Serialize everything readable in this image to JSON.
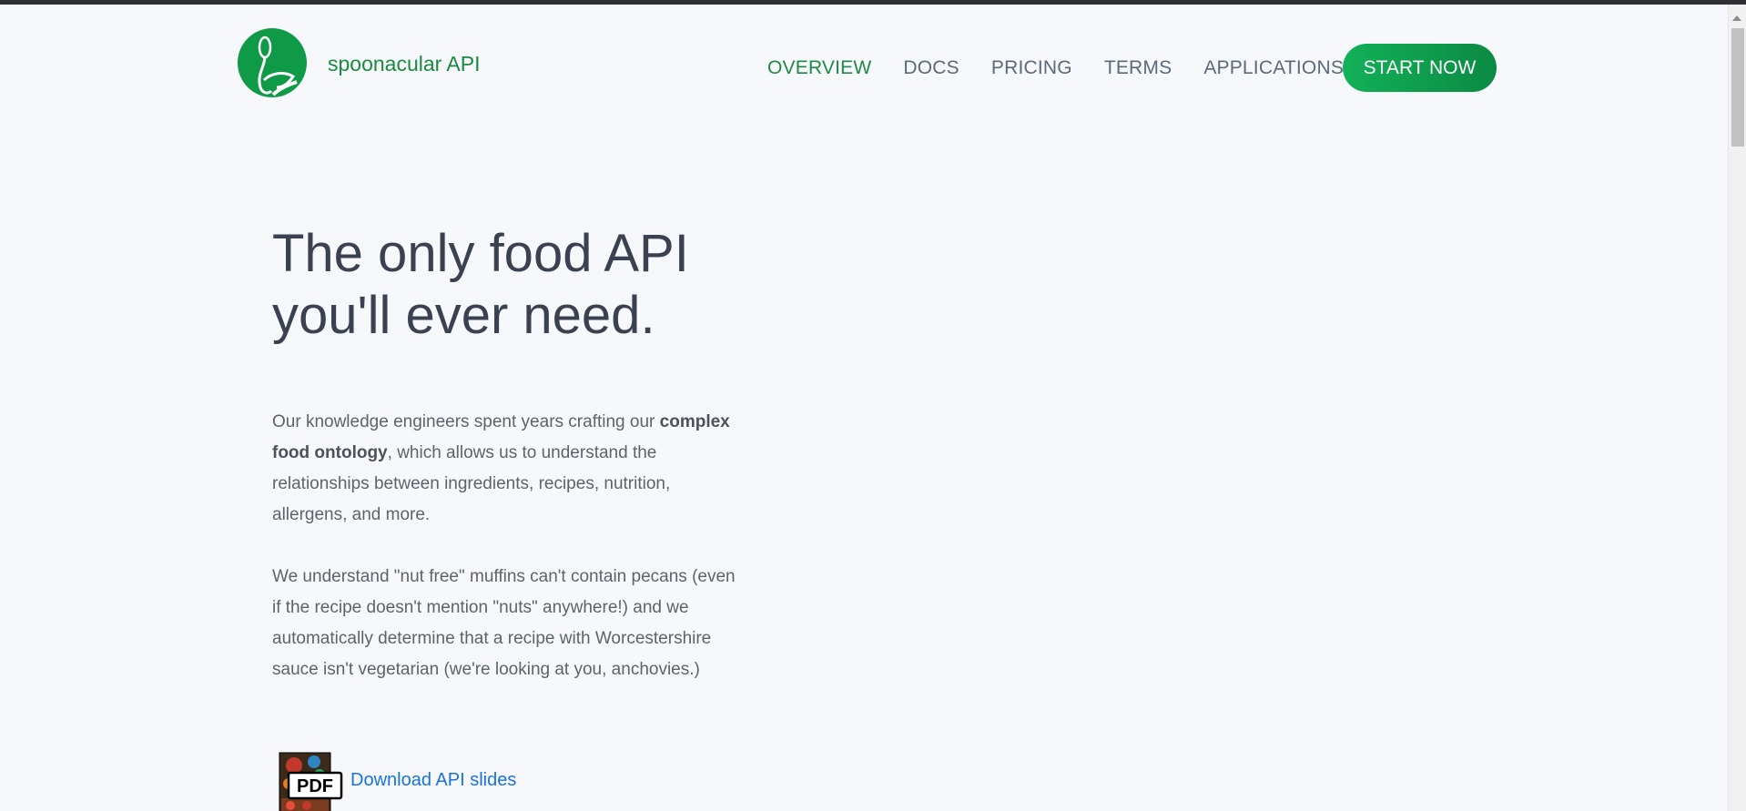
{
  "header": {
    "brand": "spoonacular API",
    "logo_icon": "spoon-logo-icon",
    "nav": [
      {
        "label": "OVERVIEW",
        "active": true
      },
      {
        "label": "DOCS",
        "active": false
      },
      {
        "label": "PRICING",
        "active": false
      },
      {
        "label": "TERMS",
        "active": false
      },
      {
        "label": "APPLICATIONS",
        "active": false
      }
    ],
    "cta": "START NOW"
  },
  "hero": {
    "title_line1": "The only food API",
    "title_line2": "you'll ever need.",
    "p1_before": "Our knowledge engineers spent years crafting our ",
    "p1_bold": "complex food ontology",
    "p1_after": ", which allows us to understand the relationships between ingredients, recipes, nutrition, allergens, and more.",
    "p2": "We understand \"nut free\" muffins can't contain pecans (even if the recipe doesn't mention \"nuts\" anywhere!) and we automatically determine that a recipe with Worcestershire sauce isn't vegetarian (we're looking at you, anchovies.)",
    "pdf_badge": "PDF",
    "download_link": "Download API slides"
  },
  "colors": {
    "brand_green": "#1a8a3f",
    "cta_gradient_start": "#12b158",
    "cta_gradient_end": "#0b8a43",
    "link_blue": "#1a73d9",
    "background": "#f6f8fb"
  }
}
